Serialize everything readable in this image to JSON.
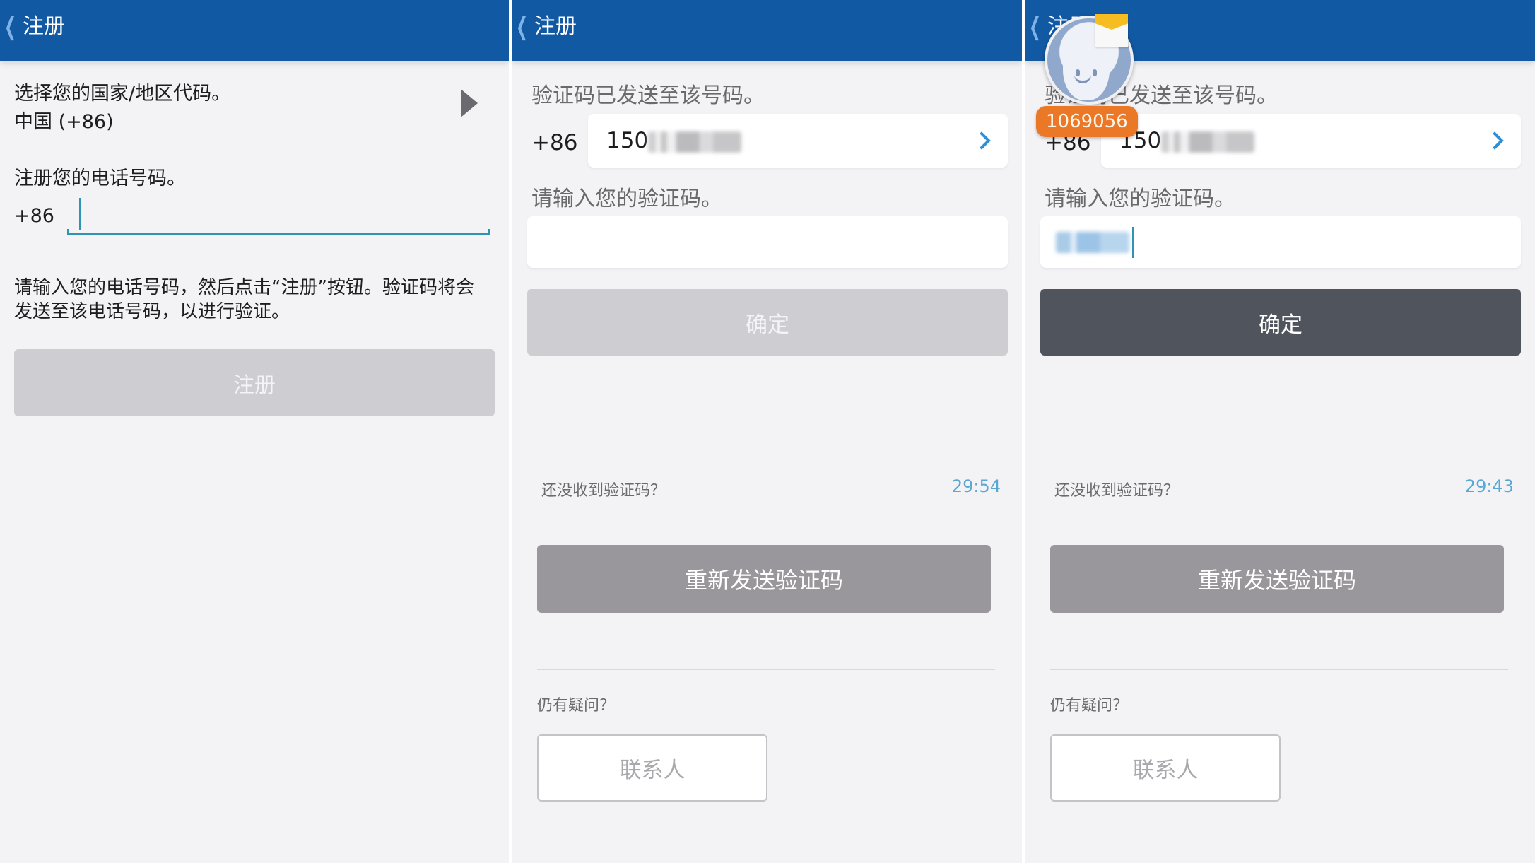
{
  "colors": {
    "header": "#1259a3",
    "accent": "#2f93b6",
    "timer": "#5aa7d6",
    "badge": "#ea7826",
    "confirm_active": "#50545c",
    "button_disabled": "#cecdd1",
    "resend": "#99979b"
  },
  "panel1": {
    "header": {
      "back_icon": "chevron-left-icon",
      "title": "注册"
    },
    "country_label": "选择您的国家/地区代码。",
    "country_value": "中国 (+86)",
    "country_arrow_icon": "play-arrow-icon",
    "phone_label": "注册您的电话号码。",
    "country_code": "+86",
    "phone_value": "",
    "help_line1": "请输入您的电话号码，然后点击“注册”按钮。验证码将会",
    "help_line2": "发送至该电话号码，以进行验证。",
    "register_button": "注册"
  },
  "panel2": {
    "header": {
      "back_icon": "chevron-left-icon",
      "title": "注册"
    },
    "sent_label": "验证码已发送至该号码。",
    "country_code": "+86",
    "phone_visible_prefix": "150",
    "phone_masked": true,
    "code_label": "请输入您的验证码。",
    "code_value": "",
    "confirm_button": "确定",
    "not_received": "还没收到验证码？",
    "timer": "29:54",
    "resend_button": "重新发送验证码",
    "still_questions": "仍有疑问？",
    "contact_button": "联系人"
  },
  "panel3": {
    "header": {
      "back_icon": "chevron-left-icon",
      "title": "注册"
    },
    "sent_label": "验证码已发送至该号码。",
    "country_code": "+86",
    "phone_visible_prefix": "150",
    "phone_masked": true,
    "code_label": "请输入您的验证码。",
    "code_masked": true,
    "confirm_button": "确定",
    "not_received": "还没收到验证码？",
    "timer": "29:43",
    "resend_button": "重新发送验证码",
    "still_questions": "仍有疑问？",
    "contact_button": "联系人",
    "notification": {
      "sender": "1069056",
      "avatar_icon": "contact-avatar-icon",
      "message_icon": "envelope-icon"
    }
  }
}
